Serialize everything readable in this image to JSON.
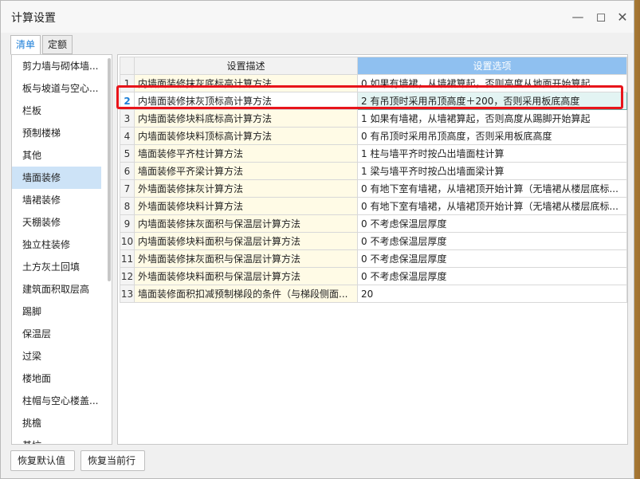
{
  "window": {
    "title": "计算设置"
  },
  "tabs": [
    {
      "label": "清单"
    },
    {
      "label": "定额"
    }
  ],
  "categories": [
    "剪力墙与砌体墙...",
    "板与坡道与空心...",
    "栏板",
    "预制楼梯",
    "其他",
    "墙面装修",
    "墙裙装修",
    "天棚装修",
    "独立柱装修",
    "土方灰土回填",
    "建筑面积取层高",
    "踢脚",
    "保温层",
    "过梁",
    "楼地面",
    "柱帽与空心楼盖...",
    "挑檐",
    "基坑"
  ],
  "selected_category": "墙面装修",
  "grid": {
    "headers": {
      "desc": "设置描述",
      "option": "设置选项"
    },
    "rows": [
      {
        "num": "1",
        "desc": "内墙面装修抹灰底标高计算方法",
        "option": "0 如果有墙裙，从墙裙算起，否则高度从地面开始算起"
      },
      {
        "num": "2",
        "desc": "内墙面装修抹灰顶标高计算方法",
        "option": "2 有吊顶时采用吊顶高度＋200，否则采用板底高度"
      },
      {
        "num": "3",
        "desc": "内墙面装修块料底标高计算方法",
        "option": "1 如果有墙裙，从墙裙算起，否则高度从踢脚开始算起"
      },
      {
        "num": "4",
        "desc": "内墙面装修块料顶标高计算方法",
        "option": "0 有吊顶时采用吊顶高度，否则采用板底高度"
      },
      {
        "num": "5",
        "desc": "墙面装修平齐柱计算方法",
        "option": "1 柱与墙平齐时按凸出墙面柱计算"
      },
      {
        "num": "6",
        "desc": "墙面装修平齐梁计算方法",
        "option": "1 梁与墙平齐时按凸出墙面梁计算"
      },
      {
        "num": "7",
        "desc": "外墙面装修抹灰计算方法",
        "option": "0 有地下室有墙裙，从墙裙顶开始计算（无墙裙从楼层底标..."
      },
      {
        "num": "8",
        "desc": "外墙面装修块料计算方法",
        "option": "0 有地下室有墙裙，从墙裙顶开始计算（无墙裙从楼层底标..."
      },
      {
        "num": "9",
        "desc": "内墙面装修抹灰面积与保温层计算方法",
        "option": "0 不考虑保温层厚度"
      },
      {
        "num": "10",
        "desc": "内墙面装修块料面积与保温层计算方法",
        "option": "0 不考虑保温层厚度"
      },
      {
        "num": "11",
        "desc": "外墙面装修抹灰面积与保温层计算方法",
        "option": "0 不考虑保温层厚度"
      },
      {
        "num": "12",
        "desc": "外墙面装修块料面积与保温层计算方法",
        "option": "0 不考虑保温层厚度"
      },
      {
        "num": "13",
        "desc": "墙面装修面积扣减预制梯段的条件（与梯段侧面...",
        "option": "20"
      }
    ],
    "selected_row": 1
  },
  "buttons": {
    "restore_default": "恢复默认值",
    "restore_current": "恢复当前行"
  },
  "colors": {
    "accent": "#1e7fd8",
    "highlight": "#e8141a",
    "header_option": "#8fc0f0"
  }
}
